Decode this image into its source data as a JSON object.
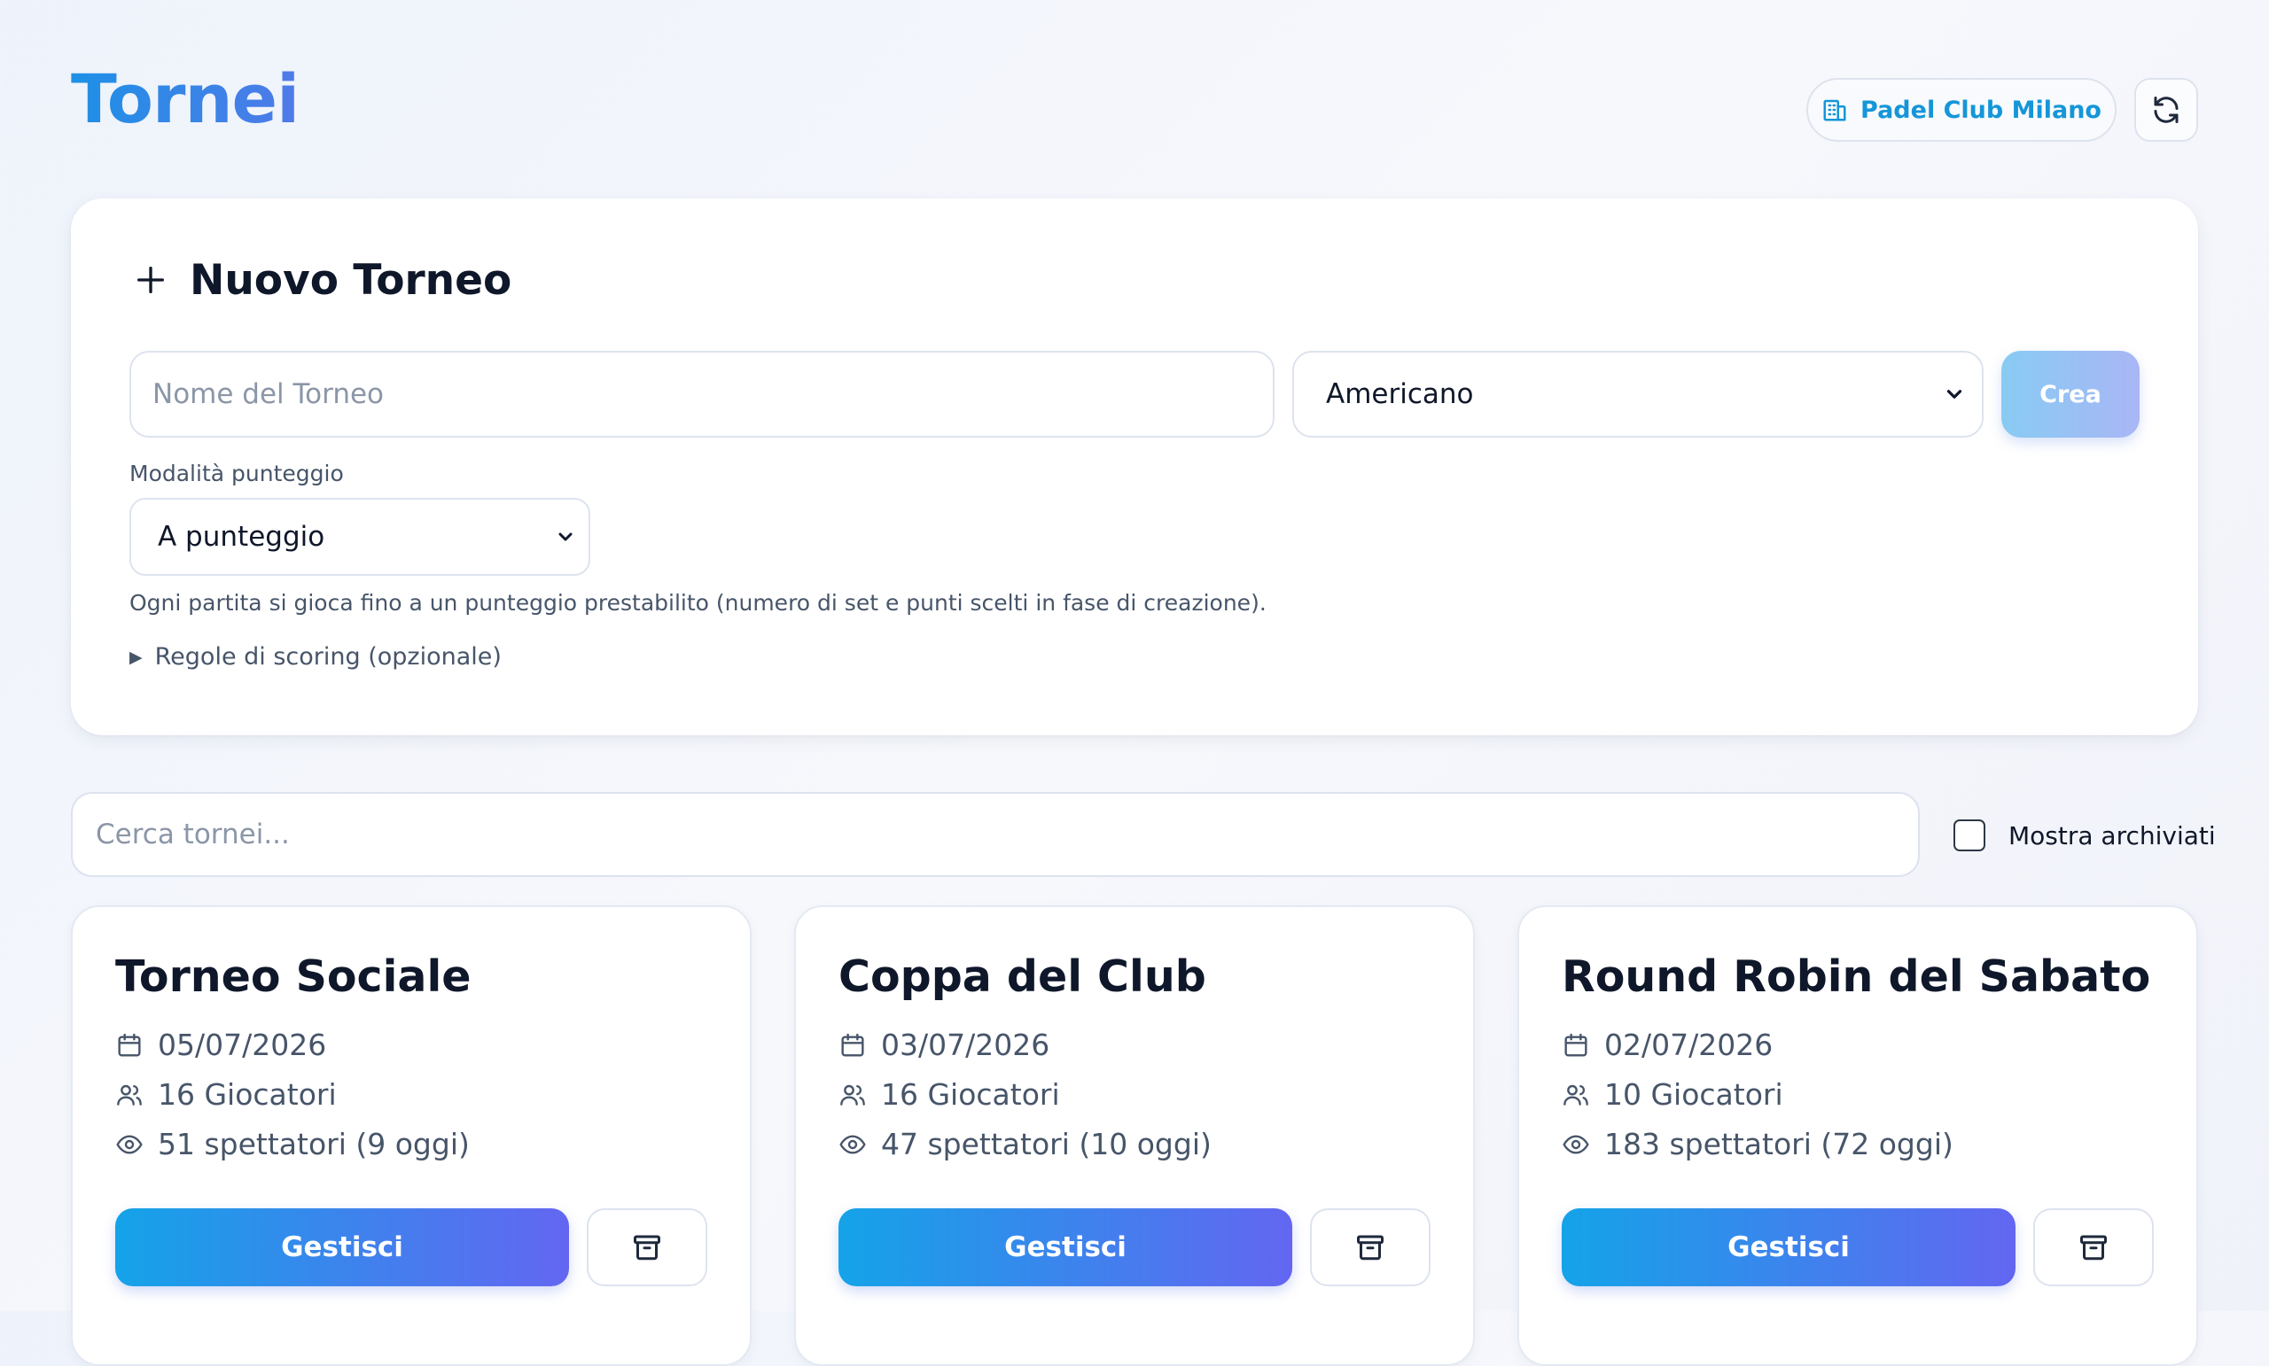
{
  "header": {
    "title": "Tornei",
    "club_name": "Padel Club Milano",
    "club_icon": "building-icon",
    "refresh_icon": "refresh-icon"
  },
  "new_tournament": {
    "title": "Nuovo Torneo",
    "name_placeholder": "Nome del Torneo",
    "type_selected": "Americano",
    "create_label": "Crea",
    "score_mode_label": "Modalità punteggio",
    "score_mode_selected": "A punteggio",
    "score_mode_hint": "Ogni partita si gioca fino a un punteggio prestabilito (numero di set e punti scelti in fase di creazione).",
    "rules_toggle": "Regole di scoring (opzionale)"
  },
  "filters": {
    "search_placeholder": "Cerca tornei...",
    "show_archived_label": "Mostra archiviati",
    "show_archived_checked": false
  },
  "tournaments": [
    {
      "title": "Torneo Sociale",
      "date": "05/07/2026",
      "players": "16 Giocatori",
      "spectators": "51 spettatori (9 oggi)",
      "manage_label": "Gestisci"
    },
    {
      "title": "Coppa del Club",
      "date": "03/07/2026",
      "players": "16 Giocatori",
      "spectators": "47 spettatori (10 oggi)",
      "manage_label": "Gestisci"
    },
    {
      "title": "Round Robin del Sabato",
      "date": "02/07/2026",
      "players": "10 Giocatori",
      "spectators": "183 spettatori (72 oggi)",
      "manage_label": "Gestisci"
    }
  ],
  "colors": {
    "accent_start": "#14a3e8",
    "accent_end": "#6366f1",
    "club_text": "#1596d8"
  }
}
